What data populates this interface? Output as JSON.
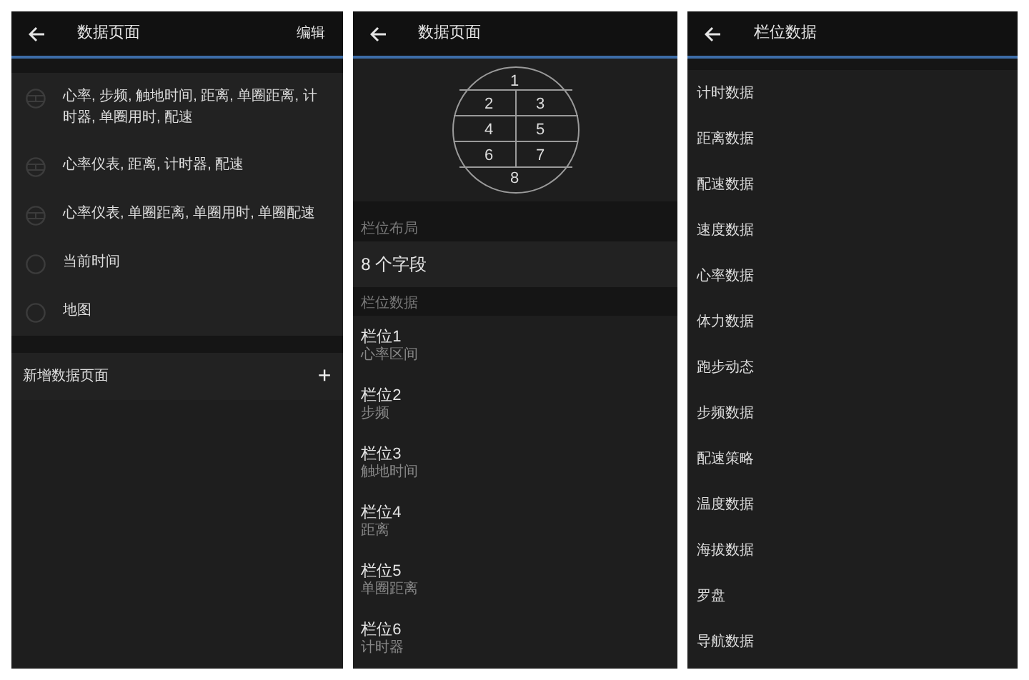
{
  "screens": [
    {
      "kind": "pages",
      "title": "数据页面",
      "action": "编辑",
      "pages": [
        {
          "kind": "multi",
          "label": "心率, 步频, 触地时间, 距离, 单圈距离, 计时器, 单圈用时, 配速"
        },
        {
          "kind": "multi",
          "label": "心率仪表, 距离, 计时器, 配速"
        },
        {
          "kind": "multi",
          "label": "心率仪表, 单圈距离, 单圈用时, 单圈配速"
        },
        {
          "kind": "single",
          "label": "当前时间"
        },
        {
          "kind": "single",
          "label": "地图"
        }
      ],
      "add_label": "新增数据页面",
      "add_icon": "+"
    },
    {
      "kind": "layout",
      "title": "数据页面",
      "diagram": [
        "1",
        "2",
        "3",
        "4",
        "5",
        "6",
        "7",
        "8"
      ],
      "layout_caption": "栏位布局",
      "layout_value": "8 个字段",
      "fields_caption": "栏位数据",
      "fields": [
        {
          "label": "栏位1",
          "value": "心率区间"
        },
        {
          "label": "栏位2",
          "value": "步频"
        },
        {
          "label": "栏位3",
          "value": "触地时间"
        },
        {
          "label": "栏位4",
          "value": "距离"
        },
        {
          "label": "栏位5",
          "value": "单圈距离"
        },
        {
          "label": "栏位6",
          "value": "计时器"
        }
      ]
    },
    {
      "kind": "categories",
      "title": "栏位数据",
      "items": [
        "计时数据",
        "距离数据",
        "配速数据",
        "速度数据",
        "心率数据",
        "体力数据",
        "跑步动态",
        "步频数据",
        "配速策略",
        "温度数据",
        "海拔数据",
        "罗盘",
        "导航数据"
      ]
    }
  ]
}
